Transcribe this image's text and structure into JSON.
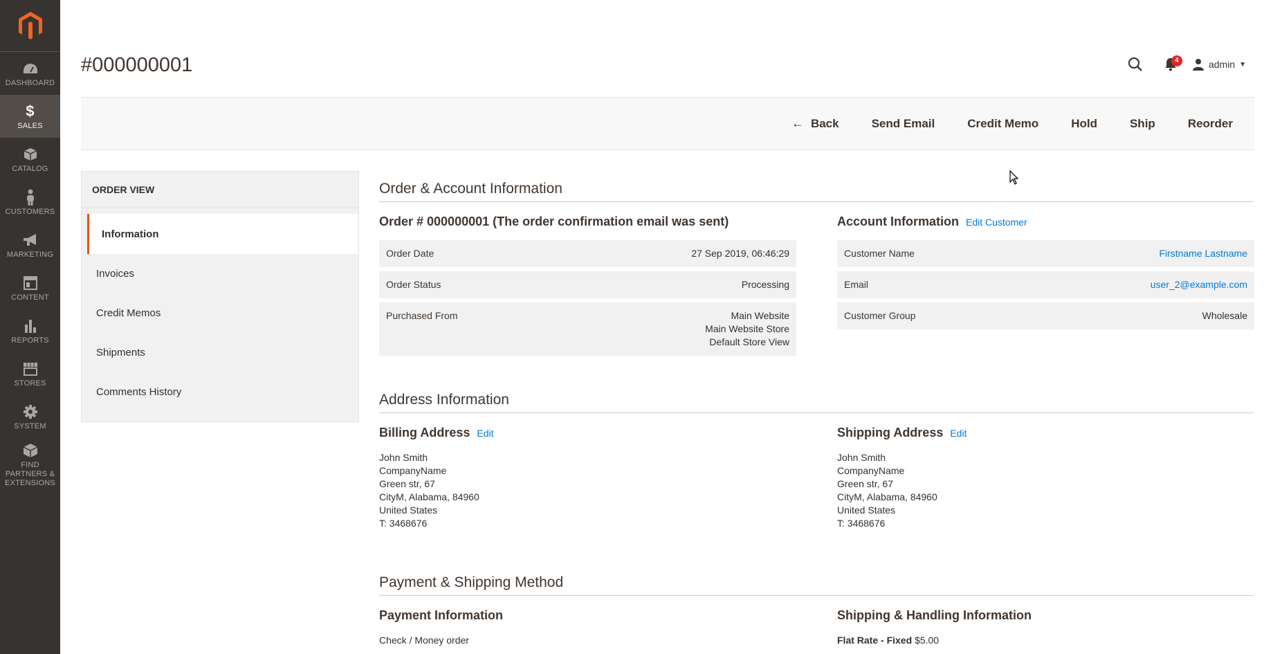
{
  "nav": {
    "items": [
      {
        "label": "DASHBOARD",
        "icon": "dashboard-icon"
      },
      {
        "label": "SALES",
        "icon": "dollar-icon",
        "active": true
      },
      {
        "label": "CATALOG",
        "icon": "cube-icon"
      },
      {
        "label": "CUSTOMERS",
        "icon": "person-icon"
      },
      {
        "label": "MARKETING",
        "icon": "megaphone-icon"
      },
      {
        "label": "CONTENT",
        "icon": "layout-icon"
      },
      {
        "label": "REPORTS",
        "icon": "bar-chart-icon"
      },
      {
        "label": "STORES",
        "icon": "store-icon"
      },
      {
        "label": "SYSTEM",
        "icon": "gear-icon"
      },
      {
        "label": "FIND PARTNERS & EXTENSIONS",
        "icon": "boxes-icon"
      }
    ]
  },
  "header": {
    "title": "#000000001",
    "notifications_count": "4",
    "user": "admin"
  },
  "actions": {
    "back": "Back",
    "send_email": "Send Email",
    "credit_memo": "Credit Memo",
    "hold": "Hold",
    "ship": "Ship",
    "reorder": "Reorder"
  },
  "side": {
    "title": "ORDER VIEW",
    "items": [
      "Information",
      "Invoices",
      "Credit Memos",
      "Shipments",
      "Comments History"
    ]
  },
  "order_account": {
    "section_title": "Order & Account Information",
    "order_heading": "Order # 000000001 (The order confirmation email was sent)",
    "order_rows": [
      {
        "label": "Order Date",
        "value": "27 Sep 2019, 06:46:29"
      },
      {
        "label": "Order Status",
        "value": "Processing"
      },
      {
        "label": "Purchased From",
        "value_lines": [
          "Main Website",
          "Main Website Store",
          "Default Store View"
        ]
      }
    ],
    "account_heading": "Account Information",
    "account_edit": "Edit Customer",
    "account_rows": [
      {
        "label": "Customer Name",
        "value": "Firstname Lastname"
      },
      {
        "label": "Email",
        "value": "user_2@example.com"
      },
      {
        "label": "Customer Group",
        "value": "Wholesale"
      }
    ]
  },
  "address": {
    "section_title": "Address Information",
    "billing_heading": "Billing Address",
    "billing_edit": "Edit",
    "billing_lines": [
      "John Smith",
      "CompanyName",
      "Green str, 67",
      "CityM, Alabama, 84960",
      "United States",
      "T: 3468676"
    ],
    "shipping_heading": "Shipping Address",
    "shipping_edit": "Edit",
    "shipping_lines": [
      "John Smith",
      "CompanyName",
      "Green str, 67",
      "CityM, Alabama, 84960",
      "United States",
      "T: 3468676"
    ]
  },
  "payment": {
    "section_title": "Payment & Shipping Method",
    "payment_heading": "Payment Information",
    "payment_method": "Check / Money order",
    "shipping_heading": "Shipping & Handling Information",
    "shipping_method": "Flat Rate - Fixed",
    "shipping_price": "$5.00"
  },
  "colors": {
    "nav_bg": "#373330",
    "accent": "#eb5202",
    "link": "#007bdb",
    "badge": "#e22626"
  }
}
